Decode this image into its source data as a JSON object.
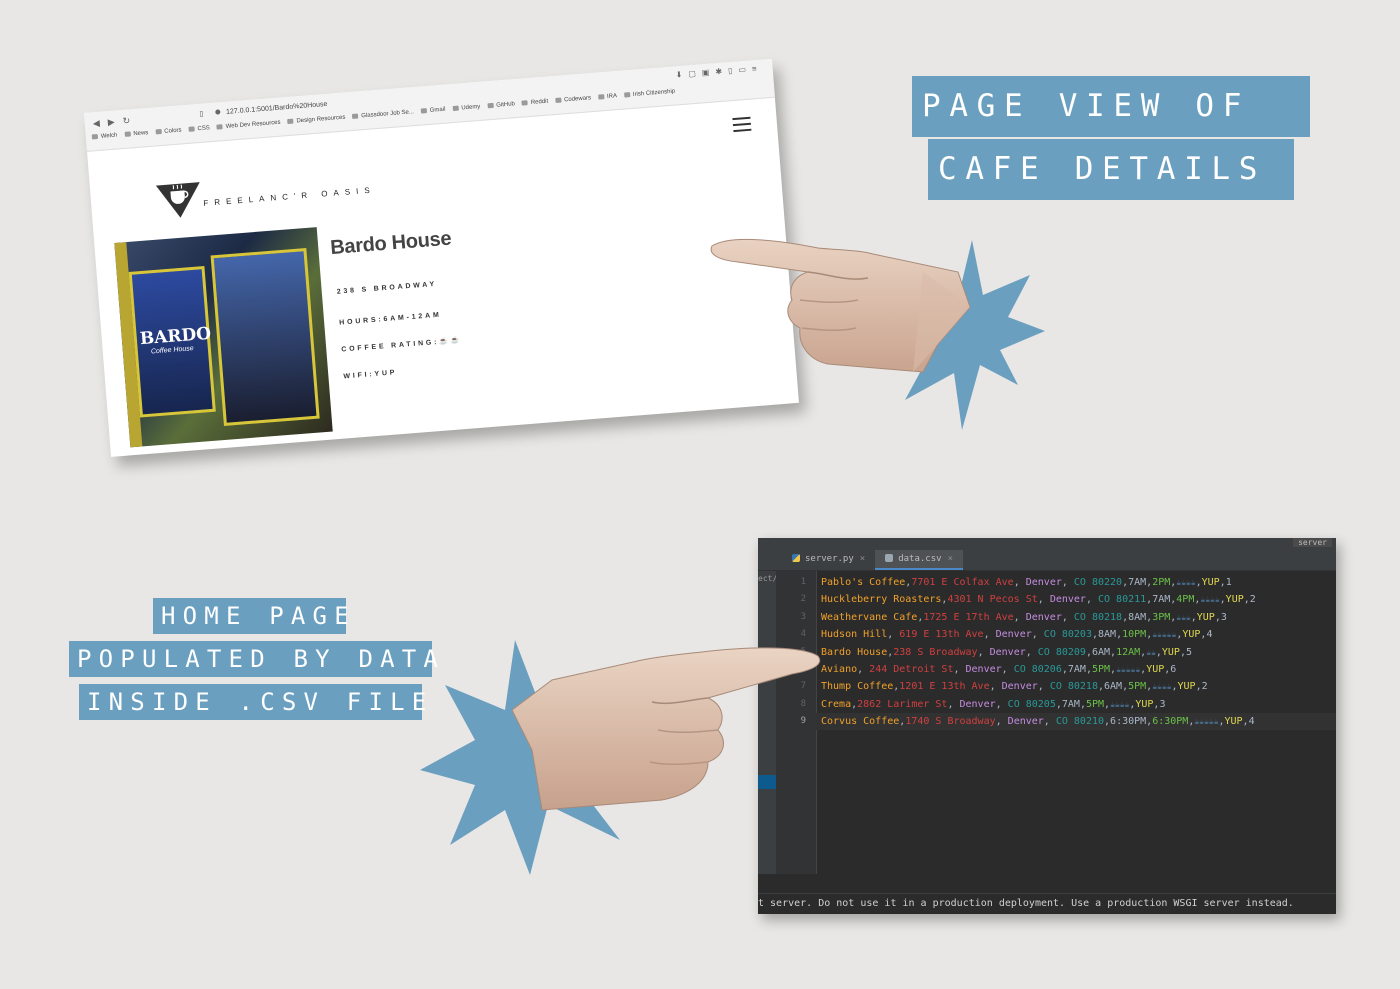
{
  "captions": {
    "top_line1": "PAGE VIEW OF",
    "top_line2": "CAFE DETAILS",
    "bottom_line1": "HOME PAGE",
    "bottom_line2": "POPULATED BY DATA",
    "bottom_line3": "INSIDE .CSV FILE"
  },
  "colors": {
    "caption_bg": "#6a9fbf",
    "background": "#e8e7e5",
    "burst": "#6a9fbf"
  },
  "browser": {
    "url": "127.0.0.1:5001/Bardo%20House",
    "bookmarks": [
      "Welch",
      "News",
      "Colors",
      "CSS",
      "Web Dev Resources",
      "Design Resources",
      "Glassdoor Job Se...",
      "Gmail",
      "Udemy",
      "GitHub",
      "Reddit",
      "Codewars",
      "IRA",
      "Irish Citizenship"
    ],
    "logo_text": "FREELANC'R OASIS",
    "cafe_name": "Bardo House",
    "address": "238 S BROADWAY",
    "hours": "HOURS:6AM-12AM",
    "coffee_rating": "COFFEE RATING:☕☕",
    "wifi": "WIFI:YUP",
    "photo_sign": "BARDO",
    "photo_sign_sub": "Coffee House",
    "icons": [
      "back-icon",
      "forward-icon",
      "reload-icon",
      "bookmark-icon",
      "menu-icon"
    ]
  },
  "ide": {
    "tabs": [
      {
        "label": "server.py",
        "active": false,
        "icon": "python-icon"
      },
      {
        "label": "data.csv",
        "active": true,
        "icon": "csv-file-icon"
      }
    ],
    "run_config": "server",
    "project_path_fragment": "ect/",
    "rows": [
      {
        "line": "1",
        "name": "Pablo's Coffee",
        "address": "7701 E Colfax Ave",
        "city": "Denver",
        "state": "CO 80220",
        "open": "7AM",
        "close": "2PM",
        "coffee": "☕☕☕☕",
        "wifi": "YUP",
        "power": "1"
      },
      {
        "line": "2",
        "name": "Huckleberry Roasters",
        "address": "4301 N Pecos St",
        "city": "Denver",
        "state": "CO 80211",
        "open": "7AM",
        "close": "4PM",
        "coffee": "☕☕☕☕",
        "wifi": "YUP",
        "power": "2"
      },
      {
        "line": "3",
        "name": "Weathervane Cafe",
        "address": "1725 E 17th Ave",
        "city": "Denver",
        "state": "CO 80218",
        "open": "8AM",
        "close": "3PM",
        "coffee": "☕☕☕",
        "wifi": "YUP",
        "power": "3"
      },
      {
        "line": "4",
        "name": "Hudson Hill",
        "address": " 619 E 13th Ave",
        "city": "Denver",
        "state": "CO 80203",
        "open": "8AM",
        "close": "10PM",
        "coffee": "☕☕☕☕☕",
        "wifi": "YUP",
        "power": "4"
      },
      {
        "line": "5",
        "name": "Bardo House",
        "address": "238 S Broadway",
        "city": "Denver",
        "state": "CO 80209",
        "open": "6AM",
        "close": "12AM",
        "coffee": "☕☕",
        "wifi": "YUP",
        "power": "5"
      },
      {
        "line": "6",
        "name": "Aviano",
        "address": " 244 Detroit St",
        "city": "Denver",
        "state": "CO 80206",
        "open": "7AM",
        "close": "5PM",
        "coffee": "☕☕☕☕☕",
        "wifi": "YUP",
        "power": "6"
      },
      {
        "line": "7",
        "name": "Thump Coffee",
        "address": "1201 E 13th Ave",
        "city": "Denver",
        "state": "CO 80218",
        "open": "6AM",
        "close": "5PM",
        "coffee": "☕☕☕☕",
        "wifi": "YUP",
        "power": "2"
      },
      {
        "line": "8",
        "name": "Crema",
        "address": "2862 Larimer St",
        "city": "Denver",
        "state": "CO 80205",
        "open": "7AM",
        "close": "5PM",
        "coffee": "☕☕☕☕",
        "wifi": "YUP",
        "power": "3"
      },
      {
        "line": "9",
        "name": "Corvus Coffee",
        "address": "1740 S Broadway",
        "city": "Denver",
        "state": "CO 80210",
        "open": "6:30PM",
        "close": "6:30PM",
        "coffee": "☕☕☕☕☕",
        "wifi": "YUP",
        "power": "4"
      }
    ],
    "console_text": "t server. Do not use it in a production deployment. Use a production WSGI server instead."
  }
}
